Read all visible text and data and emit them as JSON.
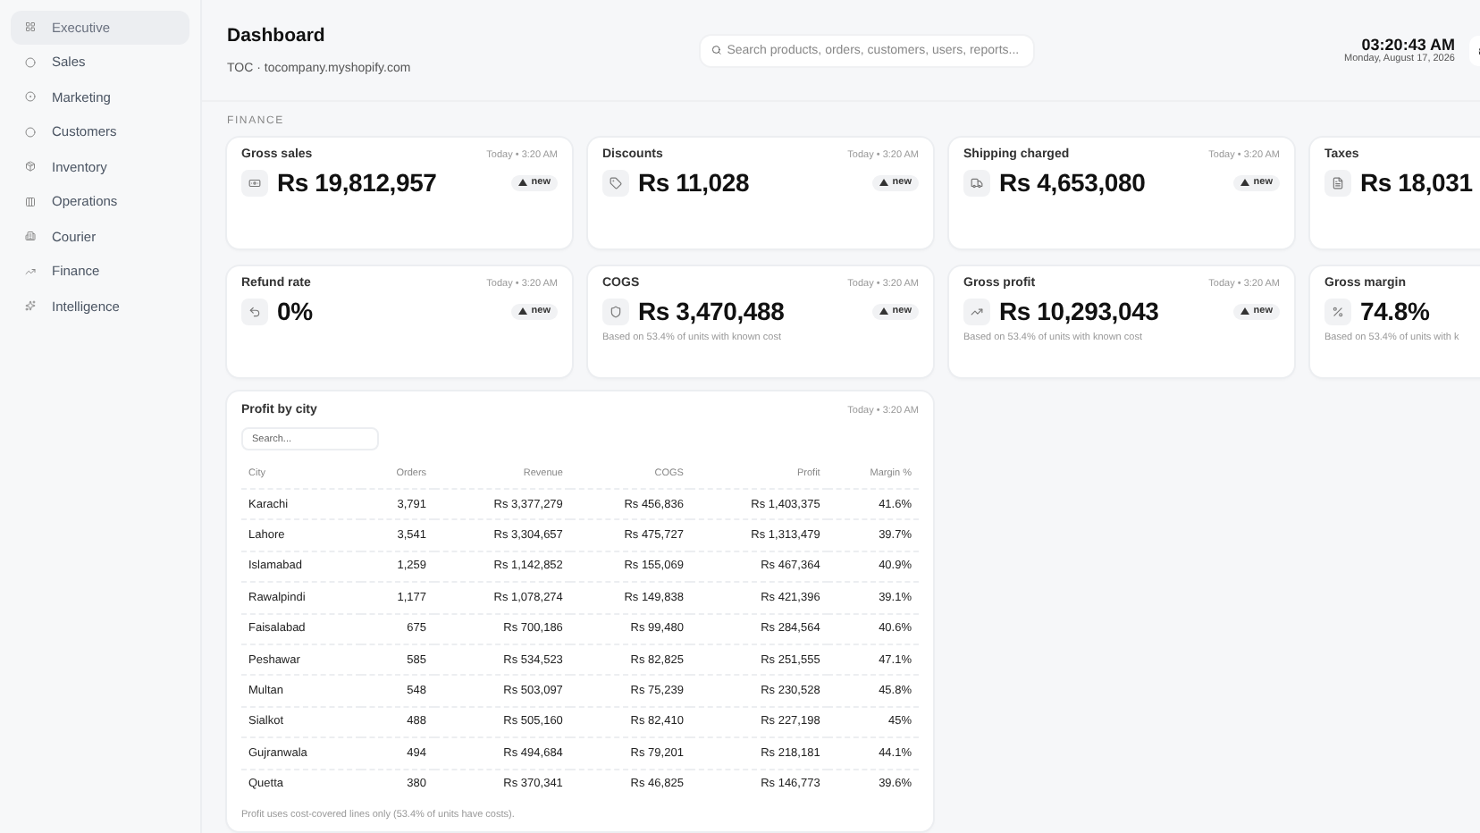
{
  "sidebar": {
    "items": [
      {
        "label": "Executive",
        "selected": true
      },
      {
        "label": "Sales",
        "selected": false
      },
      {
        "label": "Marketing",
        "selected": false
      },
      {
        "label": "Customers",
        "selected": false
      },
      {
        "label": "Inventory",
        "selected": false
      },
      {
        "label": "Operations",
        "selected": false
      },
      {
        "label": "Courier",
        "selected": false
      },
      {
        "label": "Finance",
        "selected": false
      },
      {
        "label": "Intelligence",
        "selected": false
      }
    ]
  },
  "header": {
    "title": "Dashboard",
    "subtitle": "TOC · tocompany.myshopify.com",
    "search": {
      "placeholder": "Search products, orders, customers, users, reports..."
    },
    "clock": {
      "time": "03:20:43 AM",
      "date": "Monday, August 17, 2026"
    }
  },
  "section_label": "FINANCE",
  "cards": [
    {
      "title": "Gross sales",
      "time": "Today • 3:20 AM",
      "value": "Rs 19,812,957",
      "badge": "new"
    },
    {
      "title": "Discounts",
      "time": "Today • 3:20 AM",
      "value": "Rs 11,028",
      "badge": "new"
    },
    {
      "title": "Shipping charged",
      "time": "Today • 3:20 AM",
      "value": "Rs 4,653,080",
      "badge": "new"
    },
    {
      "title": "Taxes",
      "value": "Rs 18,031"
    },
    {
      "title": "Refund rate",
      "time": "Today • 3:20 AM",
      "value": "0%",
      "badge": "new"
    },
    {
      "title": "COGS",
      "time": "Today • 3:20 AM",
      "value": "Rs 3,470,488",
      "badge": "new",
      "note": "Based on 53.4% of units with known cost"
    },
    {
      "title": "Gross profit",
      "time": "Today • 3:20 AM",
      "value": "Rs 10,293,043",
      "badge": "new",
      "note": "Based on 53.4% of units with known cost"
    },
    {
      "title": "Gross margin",
      "value": "74.8%",
      "note": "Based on 53.4% of units with k"
    }
  ],
  "table": {
    "title": "Profit by city",
    "time": "Today • 3:20 AM",
    "search": {
      "placeholder": "Search..."
    },
    "columns": [
      "City",
      "Orders",
      "Revenue",
      "COGS",
      "Profit",
      "Margin %"
    ],
    "rows": [
      [
        "Karachi",
        "3,791",
        "Rs 3,377,279",
        "Rs 456,836",
        "Rs 1,403,375",
        "41.6%"
      ],
      [
        "Lahore",
        "3,541",
        "Rs 3,304,657",
        "Rs 475,727",
        "Rs 1,313,479",
        "39.7%"
      ],
      [
        "Islamabad",
        "1,259",
        "Rs 1,142,852",
        "Rs 155,069",
        "Rs 467,364",
        "40.9%"
      ],
      [
        "Rawalpindi",
        "1,177",
        "Rs 1,078,274",
        "Rs 149,838",
        "Rs 421,396",
        "39.1%"
      ],
      [
        "Faisalabad",
        "675",
        "Rs 700,186",
        "Rs 99,480",
        "Rs 284,564",
        "40.6%"
      ],
      [
        "Peshawar",
        "585",
        "Rs 534,523",
        "Rs 82,825",
        "Rs 251,555",
        "47.1%"
      ],
      [
        "Multan",
        "548",
        "Rs 503,097",
        "Rs 75,239",
        "Rs 230,528",
        "45.8%"
      ],
      [
        "Sialkot",
        "488",
        "Rs 505,160",
        "Rs 82,410",
        "Rs 227,198",
        "45%"
      ],
      [
        "Gujranwala",
        "494",
        "Rs 494,684",
        "Rs 79,201",
        "Rs 218,181",
        "44.1%"
      ],
      [
        "Quetta",
        "380",
        "Rs 370,341",
        "Rs 46,825",
        "Rs 146,773",
        "39.6%"
      ]
    ],
    "footnote": "Profit uses cost-covered lines only (53.4% of units have costs)."
  }
}
